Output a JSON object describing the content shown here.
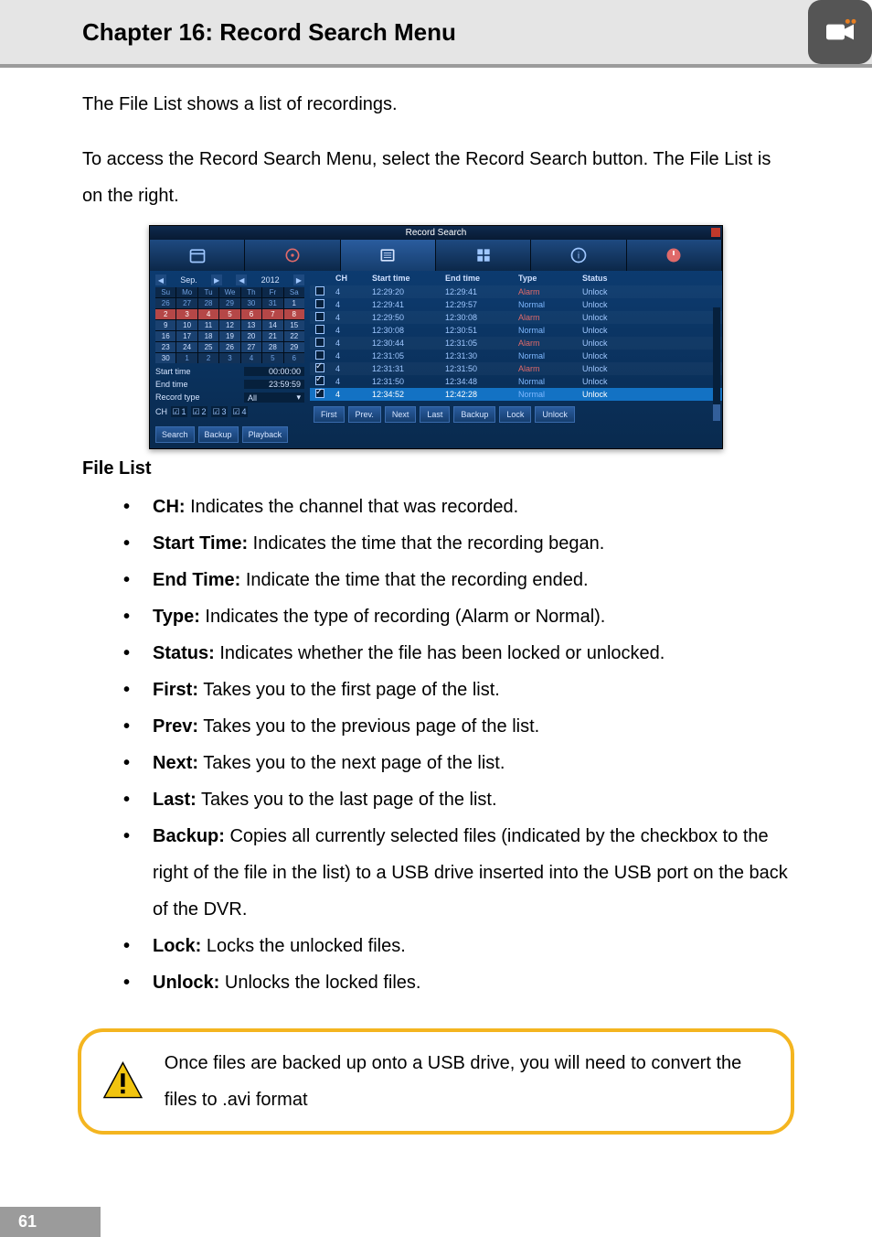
{
  "header": {
    "title": "Chapter 16: Record Search Menu",
    "icon_fill": "#ffffff"
  },
  "intro_paragraphs": [
    "The File List shows a list of recordings.",
    "To access the Record Search Menu, select the Record Search button. The File List is on the right."
  ],
  "file_list_heading": "File List",
  "bullets": [
    {
      "term": "CH:",
      "desc": " Indicates the channel that was recorded."
    },
    {
      "term": "Start Time:",
      "desc": " Indicates the time that the recording began."
    },
    {
      "term": "End Time:",
      "desc": " Indicate the time that the recording ended."
    },
    {
      "term": "Type:",
      "desc": " Indicates the type of recording (Alarm or Normal)."
    },
    {
      "term": "Status:",
      "desc": " Indicates whether the file has been locked or unlocked."
    },
    {
      "term": "First:",
      "desc": " Takes you to the first page of the list."
    },
    {
      "term": "Prev:",
      "desc": " Takes you to the previous page of the list."
    },
    {
      "term": "Next:",
      "desc": " Takes you to the next page of the list."
    },
    {
      "term": "Last:",
      "desc": " Takes you to the last page of the list."
    },
    {
      "term": "Backup:",
      "desc": " Copies all currently selected files (indicated by the checkbox to the right of the file in the list) to a USB drive inserted into the USB port on the back of the DVR."
    },
    {
      "term": "Lock:",
      "desc": " Locks the unlocked files."
    },
    {
      "term": "Unlock:",
      "desc": " Unlocks the locked files."
    }
  ],
  "note_text": "Once files are backed up onto a USB drive, you will need to convert the files to .avi format",
  "page_number": "61",
  "screenshot": {
    "title": "Record Search",
    "month_label": "Sep.",
    "year_label": "2012",
    "day_headers": [
      "Su",
      "Mo",
      "Tu",
      "We",
      "Th",
      "Fr",
      "Sa"
    ],
    "calendar": [
      {
        "d": "26",
        "dim": true
      },
      {
        "d": "27",
        "dim": true
      },
      {
        "d": "28",
        "dim": true
      },
      {
        "d": "29",
        "dim": true
      },
      {
        "d": "30",
        "dim": true
      },
      {
        "d": "31",
        "dim": true
      },
      {
        "d": "1"
      },
      {
        "d": "2",
        "hl": true
      },
      {
        "d": "3",
        "hl": true
      },
      {
        "d": "4",
        "hl": true
      },
      {
        "d": "5",
        "hl": true
      },
      {
        "d": "6",
        "hl": true
      },
      {
        "d": "7",
        "hl": true
      },
      {
        "d": "8",
        "hl": true
      },
      {
        "d": "9"
      },
      {
        "d": "10"
      },
      {
        "d": "11"
      },
      {
        "d": "12"
      },
      {
        "d": "13"
      },
      {
        "d": "14"
      },
      {
        "d": "15"
      },
      {
        "d": "16"
      },
      {
        "d": "17"
      },
      {
        "d": "18"
      },
      {
        "d": "19"
      },
      {
        "d": "20"
      },
      {
        "d": "21"
      },
      {
        "d": "22"
      },
      {
        "d": "23"
      },
      {
        "d": "24"
      },
      {
        "d": "25"
      },
      {
        "d": "26"
      },
      {
        "d": "27"
      },
      {
        "d": "28"
      },
      {
        "d": "29"
      },
      {
        "d": "30"
      },
      {
        "d": "1",
        "dim": true
      },
      {
        "d": "2",
        "dim": true
      },
      {
        "d": "3",
        "dim": true
      },
      {
        "d": "4",
        "dim": true
      },
      {
        "d": "5",
        "dim": true
      },
      {
        "d": "6",
        "dim": true
      }
    ],
    "labels": {
      "start_time": "Start time",
      "start_time_val": "00:00:00",
      "end_time": "End time",
      "end_time_val": "23:59:59",
      "record_type": "Record type",
      "record_type_val": "All",
      "ch": "CH"
    },
    "ch_opts": [
      "1",
      "2",
      "3",
      "4"
    ],
    "left_buttons": {
      "search": "Search",
      "backup": "Backup",
      "playback": "Playback"
    },
    "table": {
      "headers": {
        "ch": "CH",
        "start": "Start time",
        "end": "End time",
        "type": "Type",
        "status": "Status"
      },
      "rows": [
        {
          "checked": false,
          "ch": "4",
          "start": "12:29:20",
          "end": "12:29:41",
          "type": "Alarm",
          "status": "Unlock"
        },
        {
          "checked": false,
          "ch": "4",
          "start": "12:29:41",
          "end": "12:29:57",
          "type": "Normal",
          "status": "Unlock"
        },
        {
          "checked": false,
          "ch": "4",
          "start": "12:29:50",
          "end": "12:30:08",
          "type": "Alarm",
          "status": "Unlock"
        },
        {
          "checked": false,
          "ch": "4",
          "start": "12:30:08",
          "end": "12:30:51",
          "type": "Normal",
          "status": "Unlock"
        },
        {
          "checked": false,
          "ch": "4",
          "start": "12:30:44",
          "end": "12:31:05",
          "type": "Alarm",
          "status": "Unlock"
        },
        {
          "checked": false,
          "ch": "4",
          "start": "12:31:05",
          "end": "12:31:30",
          "type": "Normal",
          "status": "Unlock"
        },
        {
          "checked": true,
          "ch": "4",
          "start": "12:31:31",
          "end": "12:31:50",
          "type": "Alarm",
          "status": "Unlock"
        },
        {
          "checked": true,
          "ch": "4",
          "start": "12:31:50",
          "end": "12:34:48",
          "type": "Normal",
          "status": "Unlock"
        },
        {
          "checked": true,
          "ch": "4",
          "start": "12:34:52",
          "end": "12:42:28",
          "type": "Normal",
          "status": "Unlock",
          "sel": true
        }
      ],
      "footer_buttons": [
        "First",
        "Prev.",
        "Next",
        "Last",
        "Backup",
        "Lock",
        "Unlock"
      ]
    }
  }
}
